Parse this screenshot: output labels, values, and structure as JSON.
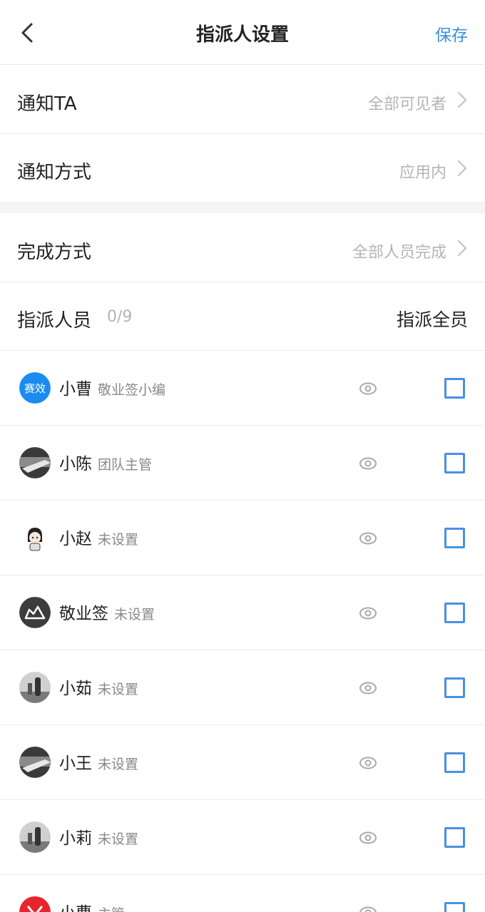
{
  "header": {
    "title": "指派人设置",
    "save_label": "保存"
  },
  "settings": {
    "notify": {
      "label": "通知TA",
      "value": "全部可见者"
    },
    "method": {
      "label": "通知方式",
      "value": "应用内"
    },
    "completion": {
      "label": "完成方式",
      "value": "全部人员完成"
    }
  },
  "assign": {
    "label": "指派人员",
    "count": "0/9",
    "all_label": "指派全员"
  },
  "avatar_badge": "赛效",
  "members": [
    {
      "name": "小曹",
      "role": "敬业签小编",
      "avatar": "blue-logo"
    },
    {
      "name": "小陈",
      "role": "团队主管",
      "avatar": "desk-photo"
    },
    {
      "name": "小赵",
      "role": "未设置",
      "avatar": "cartoon-girl"
    },
    {
      "name": "敬业签",
      "role": "未设置",
      "avatar": "dark-logo"
    },
    {
      "name": "小茹",
      "role": "未设置",
      "avatar": "bottle-photo"
    },
    {
      "name": "小王",
      "role": "未设置",
      "avatar": "desk-photo"
    },
    {
      "name": "小莉",
      "role": "未设置",
      "avatar": "bottle-photo"
    },
    {
      "name": "小曹",
      "role": "主管",
      "avatar": "red-logo"
    }
  ],
  "colors": {
    "accent": "#3d8fe0",
    "checkbox_border": "#4a90e2"
  }
}
